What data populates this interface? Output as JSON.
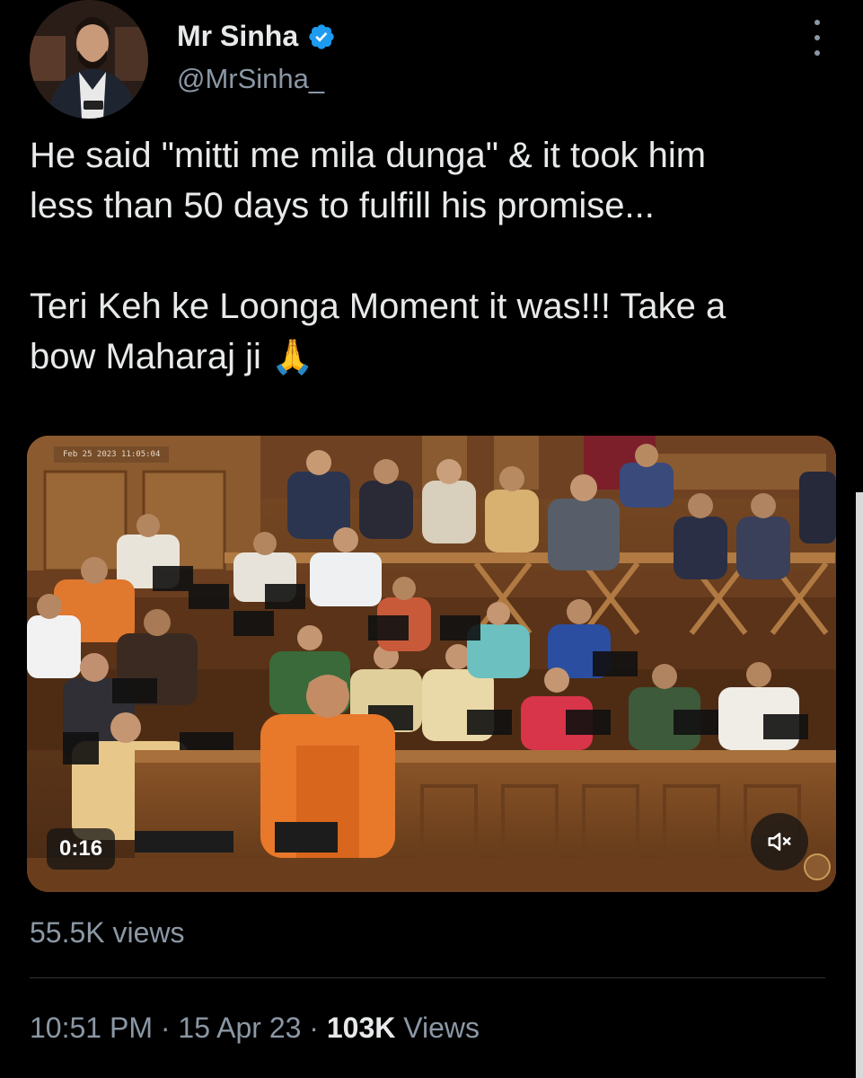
{
  "author": {
    "display_name": "Mr Sinha",
    "handle": "@MrSinha_",
    "verified": true,
    "avatar_icon": "profile-photo"
  },
  "tweet": {
    "line1": "He said \"mitti me mila dunga\" & it took him",
    "line2": "less than 50 days to fulfill his promise...",
    "line3": "Teri Keh ke Loonga Moment it was!!!  Take a",
    "line4_text": "bow Maharaj ji",
    "line4_emoji": "🙏"
  },
  "video": {
    "duration": "0:16",
    "mute_icon": "speaker-muted-icon",
    "stamp": "Feb 25 2023 11:05:04"
  },
  "stats": {
    "views_label": "55.5K views",
    "time": "10:51 PM",
    "sep1": "·",
    "date": "15 Apr 23",
    "sep2": "·",
    "view_count": "103K",
    "views_word": "Views"
  },
  "colors": {
    "background": "#000000",
    "text": "#e7e9ea",
    "secondary": "#8b98a5",
    "verified": "#1d9bf0",
    "divider": "#2f3336"
  }
}
